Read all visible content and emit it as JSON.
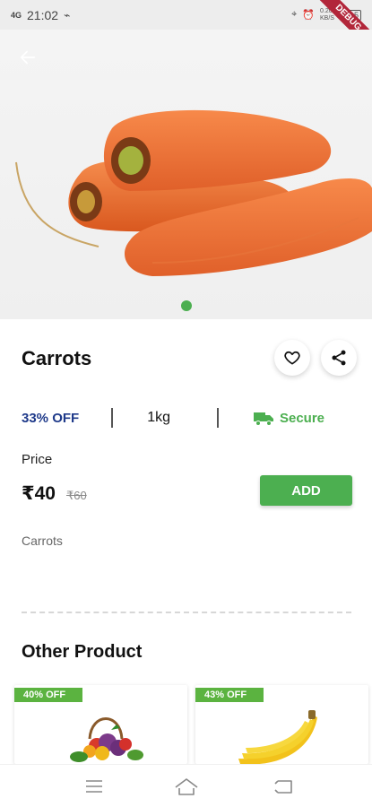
{
  "status_bar": {
    "network": "4G",
    "time": "21:02",
    "speed": "0.20 KB/S",
    "battery": "15",
    "debug": "DEBUG"
  },
  "hero": {
    "back_icon": "arrow-left-icon",
    "carousel_pages": 1,
    "carousel_active": 0
  },
  "product": {
    "name": "Carrots",
    "discount": "33% OFF",
    "weight": "1kg",
    "secure_label": "Secure",
    "price_label": "Price",
    "price": "₹40",
    "original_price": "₹60",
    "add_label": "ADD",
    "description": "Carrots"
  },
  "other": {
    "title": "Other Product",
    "items": [
      {
        "badge": "40% OFF",
        "image": "vegetable-basket"
      },
      {
        "badge": "43% OFF",
        "image": "bananas"
      }
    ]
  },
  "colors": {
    "accent_green": "#4caf50",
    "discount_blue": "#1f3a8a",
    "badge_green": "#5bb340"
  }
}
